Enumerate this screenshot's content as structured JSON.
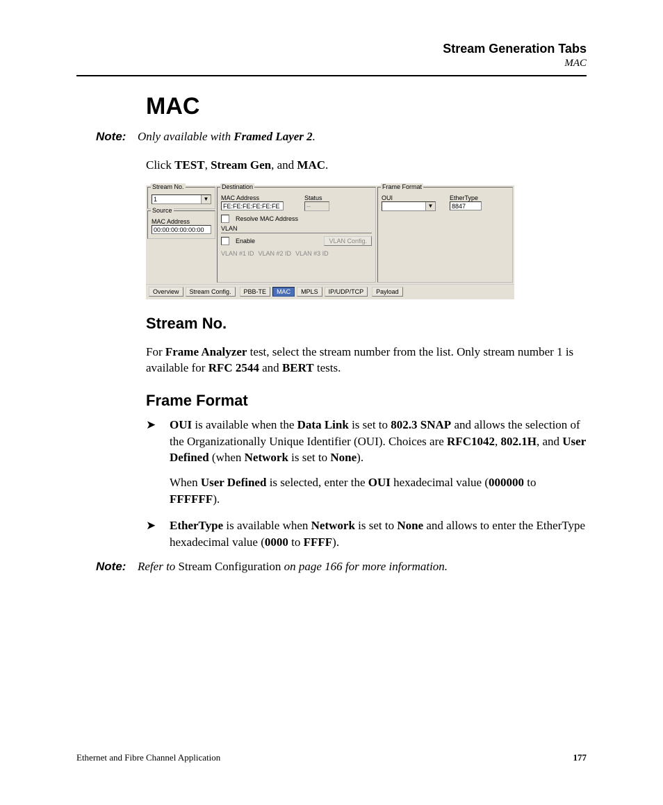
{
  "header": {
    "chapter": "Stream Generation Tabs",
    "subsection": "MAC"
  },
  "h1": "MAC",
  "note1": {
    "label": "Note:",
    "parts": [
      "Only available with ",
      "Framed Layer 2",
      "."
    ]
  },
  "click_line": {
    "t0": "Click ",
    "t1": "TEST",
    "t2": ", ",
    "t3": "Stream Gen",
    "t4": ", and ",
    "t5": "MAC",
    "t6": "."
  },
  "ui": {
    "stream_no": {
      "legend": "Stream No.",
      "value": "1"
    },
    "source": {
      "legend": "Source",
      "label": "MAC Address",
      "value": "00:00:00:00:00:00"
    },
    "destination": {
      "legend": "Destination",
      "mac_label": "MAC Address",
      "mac_value": "FE:FE:FE:FE:FE:FE",
      "status_label": "Status",
      "status_value": "--",
      "resolve": "Resolve MAC Address",
      "vlan_label": "VLAN",
      "enable": "Enable",
      "vlan_config_btn": "VLAN Config.",
      "vlan_ids": [
        "VLAN #1 ID",
        "VLAN #2 ID",
        "VLAN #3 ID"
      ]
    },
    "frame_format": {
      "legend": "Frame Format",
      "oui_label": "OUI",
      "oui_value": "",
      "ethertype_label": "EtherType",
      "ethertype_value": "8847"
    },
    "tabs": {
      "left": [
        "Overview",
        "Stream Config."
      ],
      "mid": [
        "PBB-TE",
        "MAC",
        "MPLS",
        "IP/UDP/TCP"
      ],
      "right": [
        "Payload"
      ],
      "active": "MAC"
    }
  },
  "h2_stream": "Stream No.",
  "stream_para": {
    "t0": "For ",
    "t1": "Frame Analyzer",
    "t2": " test, select the stream number from the list. Only stream number 1 is available for ",
    "t3": "RFC 2544",
    "t4": " and ",
    "t5": "BERT",
    "t6": " tests."
  },
  "h2_frame": "Frame Format",
  "bullets": {
    "b1": {
      "t0": "OUI",
      "t1": " is available when the ",
      "t2": "Data Link",
      "t3": " is set to ",
      "t4": "802.3 SNAP",
      "t5": " and allows the selection of the Organizationally Unique Identifier (OUI). Choices are ",
      "t6": "RFC1042",
      "t7": ", ",
      "t8": "802.1H",
      "t9": ", and ",
      "t10": "User Defined",
      "t11": " (when ",
      "t12": "Network",
      "t13": " is set to ",
      "t14": "None",
      "t15": ").",
      "p2_t0": "When ",
      "p2_t1": "User Defined",
      "p2_t2": " is selected, enter the ",
      "p2_t3": "OUI",
      "p2_t4": " hexadecimal value (",
      "p2_t5": "000000",
      "p2_t6": " to ",
      "p2_t7": "FFFFFF",
      "p2_t8": ")."
    },
    "b2": {
      "t0": "EtherType",
      "t1": " is available when ",
      "t2": "Network",
      "t3": " is set to ",
      "t4": "None",
      "t5": " and allows to enter the EtherType hexadecimal value (",
      "t6": "0000",
      "t7": " to ",
      "t8": "FFFF",
      "t9": ")."
    }
  },
  "note2": {
    "label": "Note:",
    "t0": "Refer to ",
    "t1": "Stream Configuration",
    "t2": " on page 166 for more information."
  },
  "footer": {
    "left": "Ethernet and Fibre Channel Application",
    "right": "177"
  }
}
